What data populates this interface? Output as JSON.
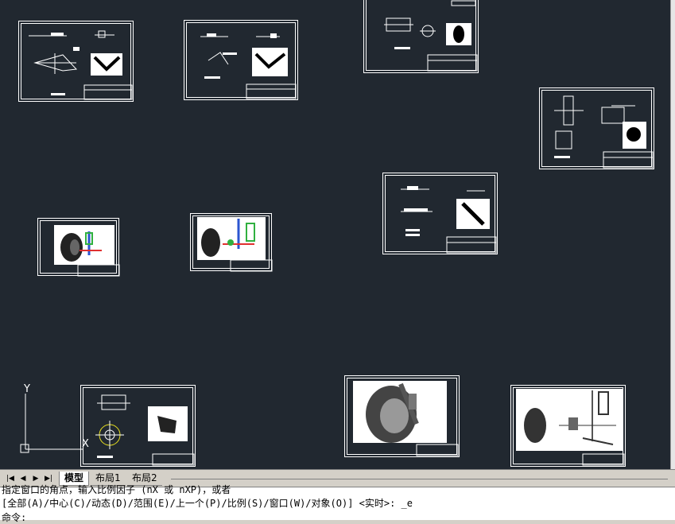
{
  "layout_tabs": [
    {
      "label": "模型",
      "active": true
    },
    {
      "label": "布局1",
      "active": false
    },
    {
      "label": "布局2",
      "active": false
    }
  ],
  "nav_buttons": [
    "first",
    "prev",
    "next",
    "last"
  ],
  "command_line": {
    "line1": "指定窗口的角点，输入比例因子 (nX 或 nXP)，或者",
    "line2": "[全部(A)/中心(C)/动态(D)/范围(E)/上一个(P)/比例(S)/窗口(W)/对象(O)] <实时>: _e",
    "line3": "命令:"
  },
  "ucs": {
    "y_label": "Y",
    "x_label": "X"
  },
  "colors": {
    "model_space_bg": "#212830",
    "line": "#ffffff",
    "accent_red": "#e03030",
    "accent_blue": "#2b55d0",
    "accent_green": "#30b040"
  }
}
